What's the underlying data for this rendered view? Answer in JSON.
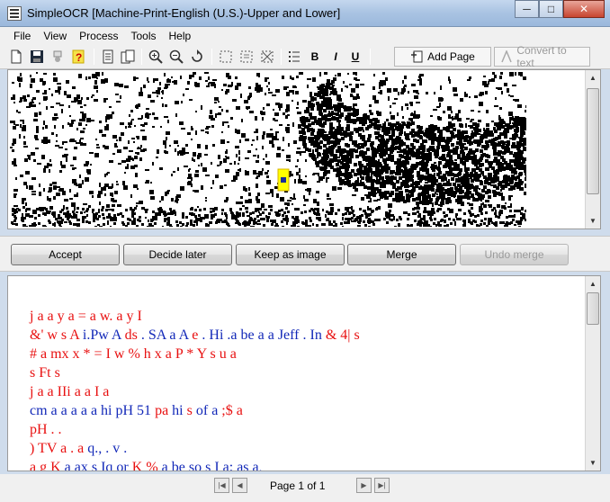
{
  "window": {
    "title": "SimpleOCR [Machine-Print-English (U.S.)-Upper and Lower]"
  },
  "title_buttons": {
    "minimize": "─",
    "maximize": "□",
    "close": "✕"
  },
  "menu": [
    "File",
    "View",
    "Process",
    "Tools",
    "Help"
  ],
  "toolbar": {
    "bold": "B",
    "italic": "I",
    "underline": "U",
    "add_page": "Add Page",
    "convert": "Convert to text"
  },
  "actions": {
    "accept": "Accept",
    "decide_later": "Decide later",
    "keep_as_image": "Keep as image",
    "merge": "Merge",
    "undo_merge": "Undo merge"
  },
  "ocr_lines": [
    [
      {
        "t": "j a a y a = a w. a y I",
        "c": "r"
      }
    ],
    [
      {
        "t": "&' w s A ",
        "c": "r"
      },
      {
        "t": "i.Pw A ",
        "c": "b"
      },
      {
        "t": "ds ",
        "c": "r"
      },
      {
        "t": ". SA a A ",
        "c": "b"
      },
      {
        "t": "e ",
        "c": "r"
      },
      {
        "t": ". Hi .a be a a Jeff . In ",
        "c": "b"
      },
      {
        "t": "& 4| s",
        "c": "r"
      }
    ],
    [
      {
        "t": "# a mx x * = I w % h x a P * Y s u a",
        "c": "r"
      }
    ],
    [
      {
        "t": "s Ft s",
        "c": "r"
      }
    ],
    [
      {
        "t": "j a a IIi a a I a",
        "c": "r"
      }
    ],
    [
      {
        "t": "cm a a a a a hi pH 51 ",
        "c": "b"
      },
      {
        "t": "pa ",
        "c": "r"
      },
      {
        "t": "hi ",
        "c": "b"
      },
      {
        "t": "s ",
        "c": "r"
      },
      {
        "t": "of a ",
        "c": "b"
      },
      {
        "t": ";$ a",
        "c": "r"
      }
    ],
    [
      {
        "t": "pH . .",
        "c": "r"
      }
    ],
    [
      {
        "t": ") TV a . a ",
        "c": "r"
      },
      {
        "t": "q., . v .",
        "c": "b"
      }
    ],
    [
      {
        "t": "a ",
        "c": "r"
      },
      {
        "t": "g K ",
        "c": "r"
      },
      {
        "t": "a ax s Iq or ",
        "c": "b"
      },
      {
        "t": "K % ",
        "c": "r"
      },
      {
        "t": "a be so s I a: as a,",
        "c": "b"
      }
    ]
  ],
  "pagination": {
    "label": "Page 1 of 1"
  },
  "colors": {
    "suspect_red": "#e81010",
    "confident_blue": "#1228b8",
    "highlight": "#ffff00"
  }
}
